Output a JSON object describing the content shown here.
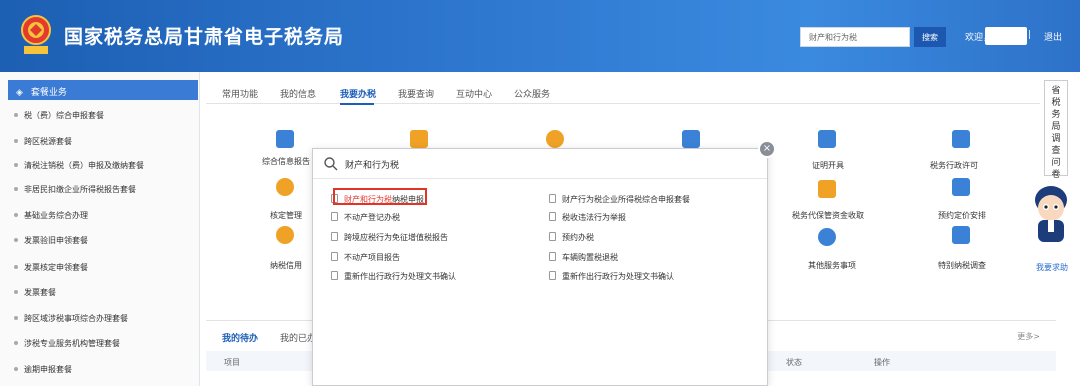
{
  "header": {
    "title": "国家税务总局甘肃省电子税务局",
    "search_value": "财产和行为税",
    "search_button": "搜索",
    "welcome": "欢迎，",
    "separator": "|",
    "logout": "退出"
  },
  "sidebar": {
    "head": "套餐业务",
    "items": [
      "税（费）综合申报套餐",
      "跨区税源套餐",
      "清税注销税（费）申报及缴纳套餐",
      "非居民扣缴企业所得税报告套餐",
      "基础业务综合办理",
      "发票验旧申领套餐",
      "发票核定申领套餐",
      "发票套餐",
      "跨区域涉税事项综合办理套餐",
      "涉税专业服务机构管理套餐",
      "逾期申报套餐"
    ]
  },
  "tabs": [
    "常用功能",
    "我的信息",
    "我要办税",
    "我要查询",
    "互动中心",
    "公众服务"
  ],
  "active_tab": "我要办税",
  "services": {
    "row1": [
      "综合信息报告",
      "证明开具",
      "税务行政许可"
    ],
    "row2": [
      "核定管理",
      "税务代保管资金收取",
      "预约定价安排"
    ],
    "row3": [
      "纳税信用",
      "其他服务事项",
      "特别纳税调查"
    ]
  },
  "right_tab": {
    "vertical_text": [
      "省",
      "税",
      "务",
      "局",
      "调",
      "查",
      "问",
      "卷"
    ],
    "help": "我要求助"
  },
  "todo": {
    "tabs": [
      "我的待办",
      "我的已办"
    ],
    "more": "更多>",
    "columns": [
      "项目",
      "状态",
      "操作"
    ]
  },
  "popup": {
    "query": "财产和行为税",
    "close": "×",
    "left_results": [
      {
        "highlight": "财产和行为税",
        "rest": "纳税申报"
      },
      {
        "highlight": "",
        "rest": "不动产登记办税"
      },
      {
        "highlight": "",
        "rest": "跨境应税行为免征增值税报告"
      },
      {
        "highlight": "",
        "rest": "不动产项目报告"
      },
      {
        "highlight": "",
        "rest": "重新作出行政行为处理文书确认"
      }
    ],
    "right_results": [
      "财产行为税企业所得税综合申报套餐",
      "税收违法行为举报",
      "预约办税",
      "车辆购置税退税",
      "重新作出行政行为处理文书确认"
    ]
  },
  "colors": {
    "header_blue": "#2f78d0",
    "active_blue": "#1d5fb8",
    "highlight_red": "#e13429"
  }
}
